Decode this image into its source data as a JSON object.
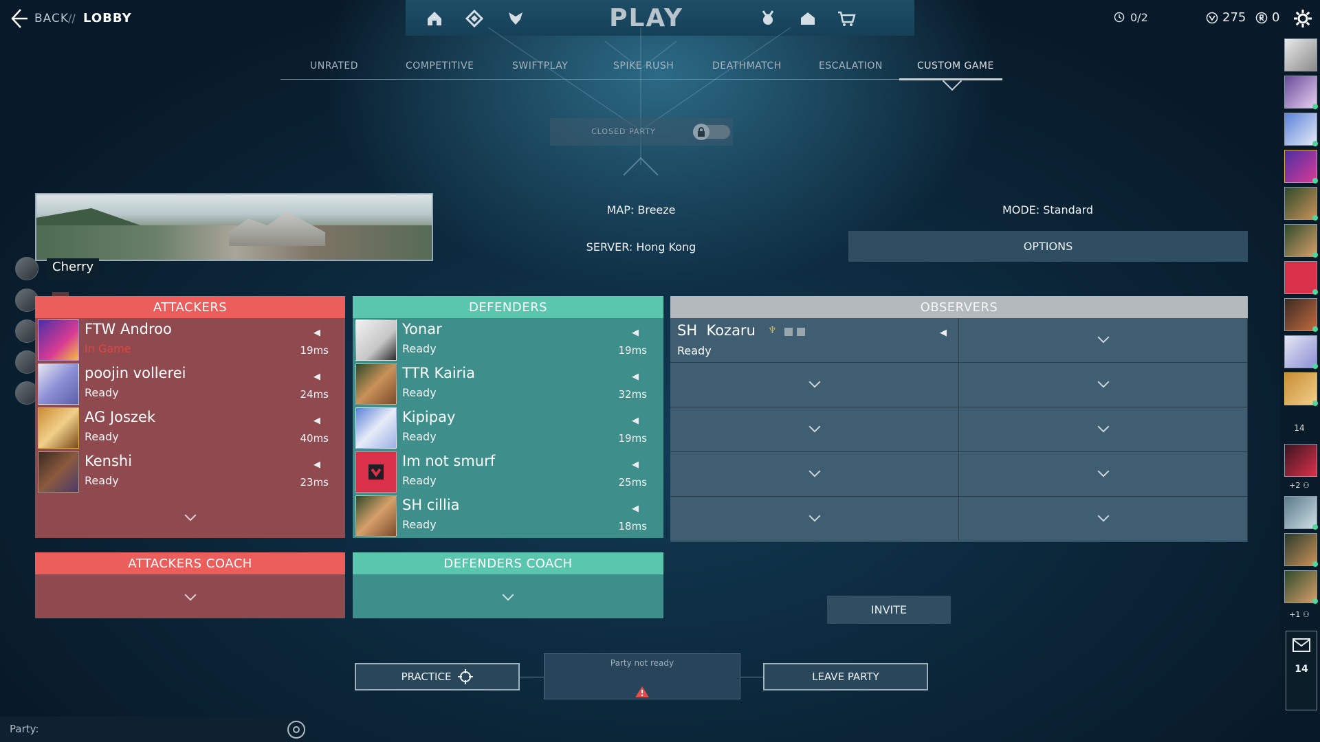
{
  "header": {
    "back_label": "BACK",
    "separator": "//",
    "breadcrumb_current": "LOBBY",
    "play_title": "PLAY",
    "timer_value": "0/2",
    "valorant_points": "275",
    "radianite_points": "0",
    "nav_icons_left": [
      "home-icon",
      "career-icon",
      "battlepass-icon"
    ],
    "nav_icons_right": [
      "agents-icon",
      "collection-icon",
      "store-icon"
    ]
  },
  "tabs": [
    {
      "label": "UNRATED",
      "active": false
    },
    {
      "label": "COMPETITIVE",
      "active": false
    },
    {
      "label": "SWIFTPLAY",
      "active": false
    },
    {
      "label": "SPIKE RUSH",
      "active": false
    },
    {
      "label": "DEATHMATCH",
      "active": false
    },
    {
      "label": "ESCALATION",
      "active": false
    },
    {
      "label": "CUSTOM GAME",
      "active": true
    }
  ],
  "party_toggle": {
    "label": "CLOSED PARTY",
    "locked": true
  },
  "settings": {
    "map_label": "MAP: Breeze",
    "mode_label": "MODE: Standard",
    "server_label": "SERVER: Hong Kong",
    "options_label": "OPTIONS"
  },
  "party_member_name": "Cherry",
  "attackers": {
    "title": "ATTACKERS",
    "players": [
      {
        "name": "FTW Androo",
        "status": "In Game",
        "ping": "19ms"
      },
      {
        "name": "poojin vollerei",
        "status": "Ready",
        "ping": "24ms"
      },
      {
        "name": "AG Joszek",
        "status": "Ready",
        "ping": "40ms"
      },
      {
        "name": "Kenshi",
        "status": "Ready",
        "ping": "23ms"
      }
    ]
  },
  "defenders": {
    "title": "DEFENDERS",
    "players": [
      {
        "name": "Yonar",
        "status": "Ready",
        "ping": "19ms"
      },
      {
        "name": "TTR Kairia",
        "status": "Ready",
        "ping": "32ms"
      },
      {
        "name": "Kipipay",
        "status": "Ready",
        "ping": "19ms"
      },
      {
        "name": "Im not smurf",
        "status": "Ready",
        "ping": "25ms"
      },
      {
        "name": "SH cillia",
        "status": "Ready",
        "ping": "18ms"
      }
    ]
  },
  "observers": {
    "title": "OBSERVERS",
    "player": {
      "name": "SH  Kozaru",
      "status": "Ready"
    }
  },
  "attackers_coach": {
    "title": "ATTACKERS COACH"
  },
  "defenders_coach": {
    "title": "DEFENDERS COACH"
  },
  "invite_label": "INVITE",
  "practice_label": "PRACTICE",
  "ready_status": "Party not ready",
  "leave_label": "LEAVE PARTY",
  "chat": {
    "label": "Party:"
  },
  "rail": {
    "friends_count": "14",
    "group1_extra": "+2",
    "group2_extra": "+1",
    "mail_count": "14"
  },
  "colors": {
    "attackers": "#ec5e5b",
    "defenders": "#5ac6ad",
    "observers": "#b3b9bd",
    "in_game": "#e0453f"
  }
}
